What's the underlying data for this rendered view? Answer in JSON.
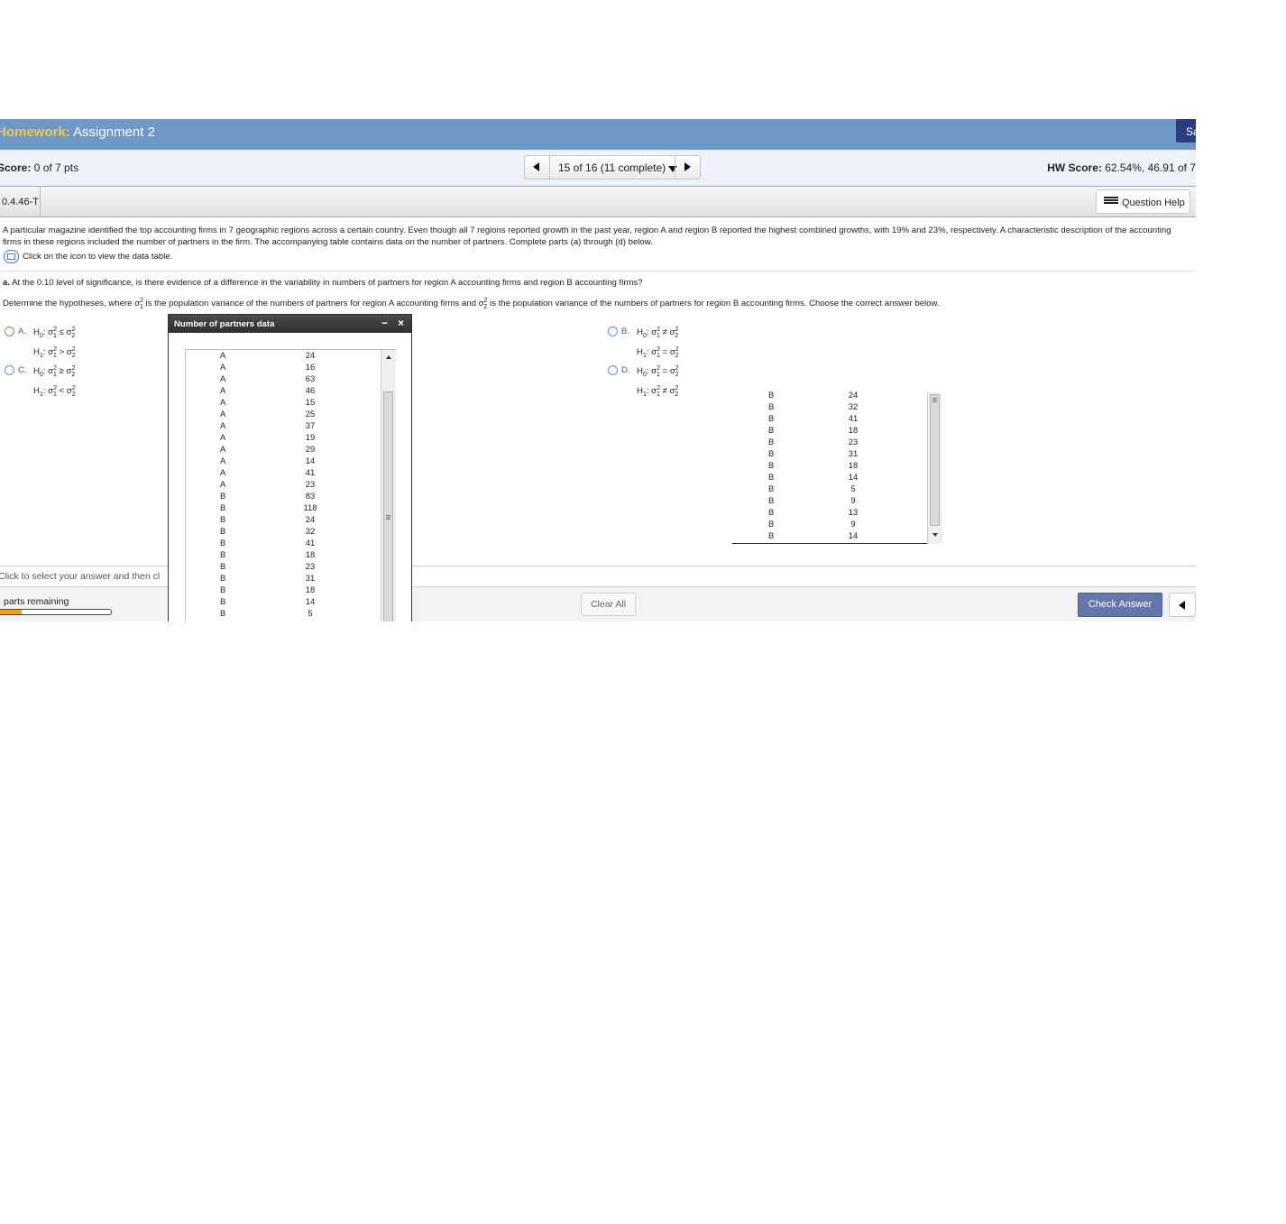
{
  "header": {
    "title_prefix": "Homework:",
    "title": "Assignment 2",
    "save_label": "Sa"
  },
  "scorebar": {
    "score_label": "Score:",
    "score_value": "0 of 7 pts",
    "nav_position": "15 of 16 (11 complete)",
    "hw_score_label": "HW Score:",
    "hw_score_value": "62.54%, 46.91 of 7"
  },
  "question": {
    "id": "0.4.46-T",
    "help_label": "Question Help",
    "intro": "A particular magazine identified the top accounting firms in 7 geographic regions across a certain country. Even though all 7 regions reported growth in the past year, region A and region B reported the highest combined growths, with 19% and 23%, respectively. A characteristic description of the accounting firms in these regions included the number of partners in the firm. The accompanying table contains data on the number of partners. Complete parts (a) through (d) below.",
    "data_link": "Click on the icon to view the data table.",
    "part_a_label": "a.",
    "part_a_text": "At the 0.10 level of significance, is there evidence of a difference in the variability in numbers of partners for region A accounting firms and region B accounting firms?",
    "determine_1": "Determine the hypotheses, where σ",
    "determine_2": " is the population variance of the numbers of partners for region A accounting firms and σ",
    "determine_3": " is the population variance of the numbers of partners for region B accounting firms. Choose the correct answer below."
  },
  "options": [
    {
      "label": "A.",
      "h0_rel": "≤",
      "h1_rel": ">"
    },
    {
      "label": "B.",
      "h0_rel": "≠",
      "h1_rel": "="
    },
    {
      "label": "C.",
      "h0_rel": "≥",
      "h1_rel": "<"
    },
    {
      "label": "D.",
      "h0_rel": "=",
      "h1_rel": "≠"
    }
  ],
  "popup": {
    "title": "Number of partners data",
    "minimize": "−",
    "close": "×",
    "rows": [
      [
        "A",
        "24"
      ],
      [
        "A",
        "16"
      ],
      [
        "A",
        "63"
      ],
      [
        "A",
        "46"
      ],
      [
        "A",
        "15"
      ],
      [
        "A",
        "25"
      ],
      [
        "A",
        "37"
      ],
      [
        "A",
        "19"
      ],
      [
        "A",
        "29"
      ],
      [
        "A",
        "14"
      ],
      [
        "A",
        "41"
      ],
      [
        "A",
        "23"
      ],
      [
        "B",
        "83"
      ],
      [
        "B",
        "118"
      ],
      [
        "B",
        "24"
      ],
      [
        "B",
        "32"
      ],
      [
        "B",
        "41"
      ],
      [
        "B",
        "18"
      ],
      [
        "B",
        "23"
      ],
      [
        "B",
        "31"
      ],
      [
        "B",
        "18"
      ],
      [
        "B",
        "14"
      ],
      [
        "B",
        "5"
      ]
    ]
  },
  "right_table": {
    "rows": [
      [
        "B",
        "24"
      ],
      [
        "B",
        "32"
      ],
      [
        "B",
        "41"
      ],
      [
        "B",
        "18"
      ],
      [
        "B",
        "23"
      ],
      [
        "B",
        "31"
      ],
      [
        "B",
        "18"
      ],
      [
        "B",
        "14"
      ],
      [
        "B",
        "5"
      ],
      [
        "B",
        "9"
      ],
      [
        "B",
        "13"
      ],
      [
        "B",
        "9"
      ],
      [
        "B",
        "14"
      ]
    ]
  },
  "footer": {
    "click_select": "Click to select your answer and then cl",
    "parts_remaining": "parts remaining",
    "progress_fraction": 0.2,
    "clear_label": "Clear All",
    "check_label": "Check Answer"
  }
}
